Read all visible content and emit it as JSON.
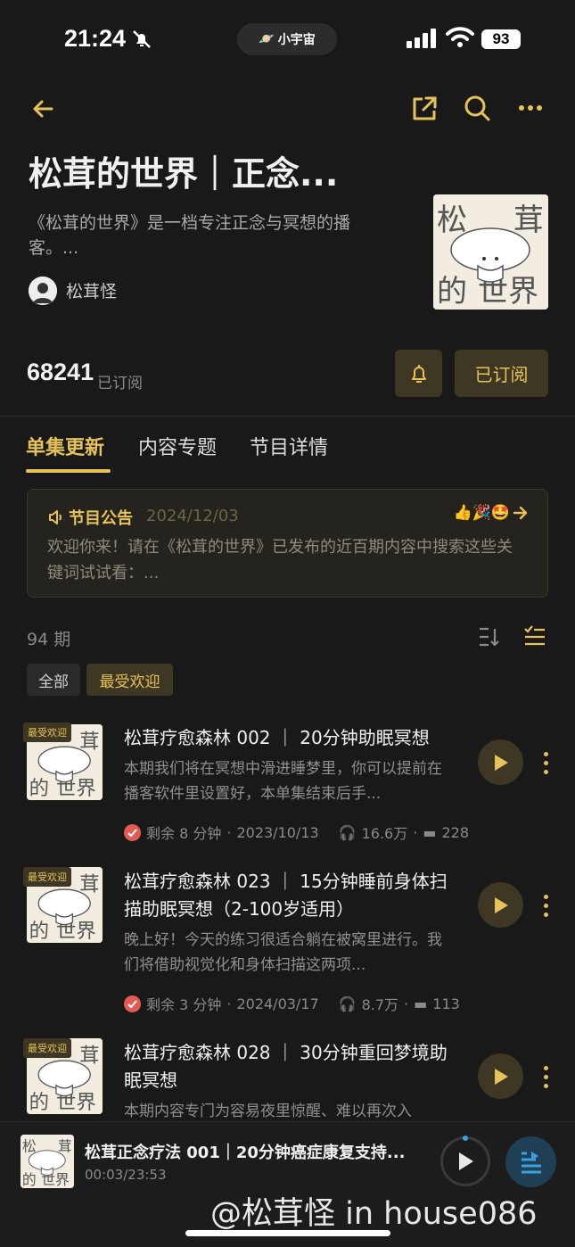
{
  "status_bar": {
    "time": "21:24",
    "island_label": "小宇宙",
    "battery": "93"
  },
  "header": {
    "title": "松茸的世界｜正念...",
    "description": "《松茸的世界》是一档专注正念与冥想的播客。...",
    "author": "松茸怪",
    "cover_text": [
      "松",
      "茸",
      "的",
      "世界"
    ]
  },
  "subscription": {
    "count": "68241",
    "label": "已订阅",
    "button_label": "已订阅"
  },
  "tabs": [
    {
      "label": "单集更新",
      "active": true
    },
    {
      "label": "内容专题",
      "active": false
    },
    {
      "label": "节目详情",
      "active": false
    }
  ],
  "notice": {
    "title": "节目公告",
    "date": "2024/12/03",
    "emojis": "👍🎉🤩",
    "body": "欢迎你来！请在《松茸的世界》已发布的近百期内容中搜索这些关键词试试看：..."
  },
  "episodes_count": "94 期",
  "filters": {
    "all": "全部",
    "popular": "最受欢迎"
  },
  "episodes": [
    {
      "badge": "最受欢迎",
      "title": "松茸疗愈森林 002 ｜ 20分钟助眠冥想",
      "desc": "本期我们将在冥想中滑进睡梦里，你可以提前在播客软件里设置好，本单集结束后手...",
      "remaining": "剩余 8 分钟",
      "date": "2023/10/13",
      "plays": "16.6万",
      "comments": "228"
    },
    {
      "badge": "最受欢迎",
      "title": "松茸疗愈森林 023 ｜ 15分钟睡前身体扫描助眠冥想（2-100岁适用）",
      "desc": "晚上好！今天的练习很适合躺在被窝里进行。我们将借助视觉化和身体扫描这两项...",
      "remaining": "剩余 3 分钟",
      "date": "2024/03/17",
      "plays": "8.7万",
      "comments": "113"
    },
    {
      "badge": "最受欢迎",
      "title": "松茸疗愈森林 028 ｜ 30分钟重回梦境助眠冥想",
      "desc": "本期内容专门为容易夜里惊醒、难以再次入"
    }
  ],
  "player": {
    "title": "松茸正念疗法 001｜20分钟癌症康复支持...",
    "time": "00:03/23:53",
    "progress": 0.002
  },
  "watermark": "@松茸怪 in house086",
  "colors": {
    "accent": "#e6c35a",
    "background": "#191919",
    "accent_bg": "#3e3724",
    "check": "#e35b55"
  }
}
